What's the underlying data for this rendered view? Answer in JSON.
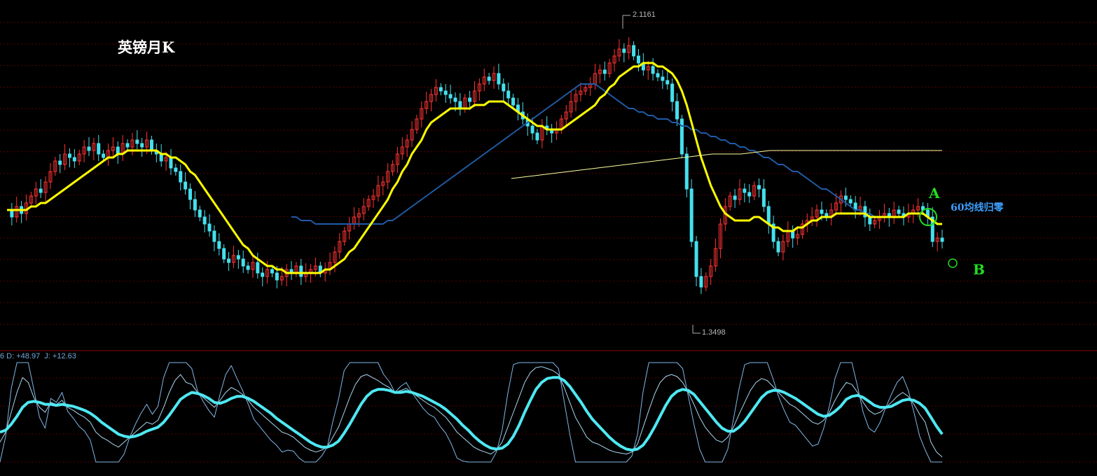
{
  "title": "英镑月K",
  "indicator_label": "6 D: +48.97  J: +12.63",
  "annotations": {
    "a": "A",
    "b": "B",
    "ma60_note": "60均线归零"
  },
  "price_high": "2.1161",
  "price_low": "1.3498",
  "colors": {
    "background": "#000000",
    "grid": "#5a0000",
    "candle_up": "#ff3333",
    "candle_down": "#45e0ee",
    "ma_main": "#ffff00",
    "ma_60": "#1f5ca8",
    "ma_long": "#ffffa0",
    "kdj_main": "#4ee8f2",
    "marker": "#22dd22"
  },
  "chart_data": [
    {
      "type": "candlestick",
      "title": "英镑月K",
      "ylim": [
        1.3,
        2.17
      ],
      "extremes": {
        "high": 2.1161,
        "low": 1.3498
      },
      "close": [
        1.64,
        1.62,
        1.65,
        1.63,
        1.66,
        1.68,
        1.7,
        1.69,
        1.72,
        1.75,
        1.78,
        1.77,
        1.8,
        1.79,
        1.78,
        1.8,
        1.82,
        1.81,
        1.83,
        1.8,
        1.79,
        1.81,
        1.82,
        1.8,
        1.83,
        1.82,
        1.84,
        1.83,
        1.82,
        1.84,
        1.81,
        1.8,
        1.78,
        1.79,
        1.76,
        1.75,
        1.72,
        1.7,
        1.67,
        1.64,
        1.62,
        1.6,
        1.58,
        1.55,
        1.53,
        1.5,
        1.49,
        1.51,
        1.5,
        1.48,
        1.47,
        1.49,
        1.46,
        1.45,
        1.47,
        1.46,
        1.44,
        1.45,
        1.47,
        1.46,
        1.48,
        1.45,
        1.46,
        1.47,
        1.48,
        1.46,
        1.47,
        1.49,
        1.52,
        1.55,
        1.58,
        1.6,
        1.62,
        1.63,
        1.65,
        1.67,
        1.68,
        1.71,
        1.72,
        1.75,
        1.77,
        1.8,
        1.82,
        1.84,
        1.87,
        1.9,
        1.93,
        1.95,
        1.97,
        1.99,
        1.98,
        1.97,
        1.96,
        1.95,
        1.93,
        1.96,
        1.95,
        1.98,
        2.0,
        2.02,
        2.01,
        2.03,
        2.0,
        1.98,
        1.96,
        1.94,
        1.92,
        1.9,
        1.88,
        1.86,
        1.84,
        1.88,
        1.87,
        1.86,
        1.87,
        1.9,
        1.92,
        1.95,
        1.97,
        1.98,
        1.99,
        2.0,
        2.03,
        2.04,
        2.03,
        2.06,
        2.08,
        2.1,
        2.09,
        2.11,
        2.08,
        2.06,
        2.04,
        2.05,
        2.03,
        2.02,
        2.01,
        2.0,
        1.95,
        1.9,
        1.8,
        1.7,
        1.55,
        1.45,
        1.42,
        1.45,
        1.48,
        1.53,
        1.6,
        1.65,
        1.68,
        1.67,
        1.7,
        1.69,
        1.68,
        1.71,
        1.7,
        1.65,
        1.6,
        1.55,
        1.52,
        1.55,
        1.58,
        1.56,
        1.57,
        1.6,
        1.61,
        1.62,
        1.64,
        1.63,
        1.62,
        1.64,
        1.66,
        1.68,
        1.67,
        1.66,
        1.64,
        1.65,
        1.62,
        1.6,
        1.61,
        1.62,
        1.63,
        1.62,
        1.64,
        1.63,
        1.62,
        1.63,
        1.64,
        1.65,
        1.64,
        1.62,
        1.55,
        1.56,
        1.55
      ],
      "ma_main": [
        1.64,
        1.64,
        1.64,
        1.64,
        1.64,
        1.65,
        1.65,
        1.66,
        1.66,
        1.67,
        1.68,
        1.69,
        1.7,
        1.71,
        1.72,
        1.73,
        1.74,
        1.75,
        1.76,
        1.77,
        1.78,
        1.79,
        1.79,
        1.8,
        1.8,
        1.81,
        1.81,
        1.81,
        1.81,
        1.81,
        1.81,
        1.81,
        1.8,
        1.8,
        1.79,
        1.79,
        1.78,
        1.77,
        1.75,
        1.74,
        1.72,
        1.7,
        1.68,
        1.66,
        1.64,
        1.62,
        1.6,
        1.58,
        1.56,
        1.54,
        1.53,
        1.51,
        1.5,
        1.49,
        1.48,
        1.48,
        1.47,
        1.47,
        1.46,
        1.46,
        1.46,
        1.46,
        1.46,
        1.46,
        1.46,
        1.46,
        1.47,
        1.47,
        1.48,
        1.49,
        1.5,
        1.52,
        1.53,
        1.55,
        1.57,
        1.59,
        1.61,
        1.63,
        1.65,
        1.67,
        1.7,
        1.72,
        1.75,
        1.77,
        1.8,
        1.82,
        1.84,
        1.87,
        1.89,
        1.9,
        1.91,
        1.92,
        1.93,
        1.93,
        1.93,
        1.93,
        1.93,
        1.94,
        1.94,
        1.94,
        1.95,
        1.95,
        1.95,
        1.95,
        1.94,
        1.93,
        1.92,
        1.91,
        1.9,
        1.89,
        1.88,
        1.88,
        1.87,
        1.87,
        1.87,
        1.87,
        1.88,
        1.89,
        1.9,
        1.91,
        1.92,
        1.93,
        1.94,
        1.96,
        1.97,
        1.99,
        2.0,
        2.02,
        2.03,
        2.04,
        2.05,
        2.05,
        2.06,
        2.06,
        2.06,
        2.05,
        2.05,
        2.04,
        2.03,
        2.01,
        1.98,
        1.94,
        1.89,
        1.84,
        1.79,
        1.75,
        1.71,
        1.68,
        1.65,
        1.63,
        1.62,
        1.61,
        1.61,
        1.61,
        1.61,
        1.62,
        1.62,
        1.61,
        1.6,
        1.59,
        1.59,
        1.58,
        1.58,
        1.58,
        1.59,
        1.59,
        1.6,
        1.61,
        1.61,
        1.62,
        1.62,
        1.62,
        1.63,
        1.63,
        1.63,
        1.63,
        1.63,
        1.63,
        1.63,
        1.62,
        1.62,
        1.62,
        1.62,
        1.62,
        1.62,
        1.62,
        1.62,
        1.63,
        1.63,
        1.63,
        1.63,
        1.62,
        1.61,
        1.6,
        1.6
      ],
      "ma_60": [
        null,
        null,
        null,
        null,
        null,
        null,
        null,
        null,
        null,
        null,
        null,
        null,
        null,
        null,
        null,
        null,
        null,
        null,
        null,
        null,
        null,
        null,
        null,
        null,
        null,
        null,
        null,
        null,
        null,
        null,
        null,
        null,
        null,
        null,
        null,
        null,
        null,
        null,
        null,
        null,
        null,
        null,
        null,
        null,
        null,
        null,
        null,
        null,
        null,
        null,
        null,
        null,
        null,
        null,
        null,
        null,
        null,
        null,
        null,
        1.62,
        1.62,
        1.61,
        1.61,
        1.61,
        1.6,
        1.6,
        1.6,
        1.6,
        1.6,
        1.6,
        1.6,
        1.6,
        1.6,
        1.6,
        1.6,
        1.6,
        1.6,
        1.6,
        1.6,
        1.61,
        1.61,
        1.62,
        1.63,
        1.64,
        1.65,
        1.66,
        1.67,
        1.68,
        1.69,
        1.7,
        1.71,
        1.72,
        1.73,
        1.74,
        1.75,
        1.76,
        1.77,
        1.78,
        1.79,
        1.8,
        1.81,
        1.82,
        1.83,
        1.84,
        1.85,
        1.86,
        1.87,
        1.88,
        1.89,
        1.9,
        1.91,
        1.92,
        1.93,
        1.94,
        1.95,
        1.96,
        1.97,
        1.98,
        1.99,
        2.0,
        2.0,
        2.0,
        2.0,
        1.99,
        1.98,
        1.97,
        1.96,
        1.95,
        1.94,
        1.93,
        1.93,
        1.92,
        1.92,
        1.91,
        1.91,
        1.9,
        1.9,
        1.9,
        1.89,
        1.89,
        1.88,
        1.88,
        1.87,
        1.87,
        1.86,
        1.86,
        1.85,
        1.85,
        1.84,
        1.84,
        1.83,
        1.83,
        1.82,
        1.82,
        1.81,
        1.81,
        1.8,
        1.79,
        1.79,
        1.78,
        1.77,
        1.77,
        1.76,
        1.75,
        1.75,
        1.74,
        1.73,
        1.72,
        1.71,
        1.7,
        1.7,
        1.69,
        1.68,
        1.67,
        1.66,
        1.65,
        1.64,
        1.64,
        1.63,
        1.63,
        1.62
      ],
      "ma_long": [
        1.73,
        1.74,
        1.75,
        1.76,
        1.77,
        1.78,
        1.79,
        1.8,
        1.8,
        1.81,
        1.81,
        1.81,
        1.81,
        1.81,
        1.81,
        1.81
      ]
    },
    {
      "type": "line",
      "title": "KDJ",
      "ylim": [
        0,
        100
      ],
      "K": [
        20,
        30,
        50,
        70,
        85,
        80,
        65,
        55,
        50,
        60,
        58,
        62,
        55,
        52,
        48,
        45,
        40,
        30,
        25,
        22,
        18,
        15,
        20,
        25,
        30,
        35,
        40,
        38,
        42,
        55,
        70,
        82,
        88,
        80,
        78,
        70,
        65,
        60,
        55,
        62,
        70,
        75,
        72,
        68,
        62,
        55,
        50,
        45,
        40,
        35,
        30,
        28,
        25,
        20,
        15,
        12,
        10,
        12,
        15,
        25,
        35,
        50,
        65,
        78,
        86,
        88,
        85,
        82,
        78,
        75,
        70,
        72,
        74,
        70,
        66,
        62,
        58,
        55,
        50,
        45,
        38,
        30,
        25,
        20,
        15,
        12,
        10,
        8,
        12,
        20,
        35,
        50,
        65,
        80,
        90,
        95,
        96,
        94,
        92,
        88,
        75,
        60,
        45,
        35,
        25,
        20,
        18,
        15,
        12,
        10,
        9,
        8,
        10,
        18,
        35,
        52,
        68,
        80,
        86,
        88,
        86,
        80,
        70,
        58,
        45,
        35,
        28,
        22,
        20,
        25,
        35,
        48,
        60,
        72,
        80,
        84,
        82,
        76,
        70,
        64,
        58,
        55,
        50,
        45,
        40,
        38,
        42,
        50,
        62,
        72,
        80,
        78,
        70,
        60,
        52,
        48,
        50,
        55,
        60,
        66,
        70,
        66,
        58,
        48,
        40,
        20,
        10,
        5
      ],
      "D": [
        30,
        32,
        38,
        46,
        55,
        60,
        61,
        60,
        58,
        58,
        57,
        58,
        57,
        56,
        54,
        52,
        49,
        45,
        40,
        36,
        32,
        28,
        26,
        25,
        26,
        28,
        31,
        33,
        35,
        40,
        47,
        55,
        63,
        67,
        70,
        69,
        67,
        64,
        60,
        59,
        61,
        64,
        66,
        66,
        64,
        61,
        57,
        53,
        49,
        44,
        40,
        36,
        32,
        28,
        24,
        20,
        17,
        15,
        15,
        17,
        21,
        29,
        38,
        48,
        58,
        66,
        71,
        73,
        73,
        72,
        70,
        70,
        71,
        70,
        68,
        66,
        63,
        60,
        57,
        53,
        48,
        43,
        37,
        32,
        26,
        21,
        17,
        14,
        13,
        14,
        18,
        26,
        37,
        50,
        62,
        73,
        80,
        84,
        85,
        85,
        82,
        76,
        68,
        60,
        51,
        43,
        37,
        31,
        25,
        20,
        16,
        13,
        12,
        13,
        17,
        25,
        35,
        46,
        57,
        66,
        71,
        73,
        72,
        68,
        61,
        54,
        47,
        40,
        34,
        31,
        31,
        35,
        41,
        49,
        57,
        65,
        70,
        72,
        72,
        70,
        67,
        64,
        60,
        56,
        52,
        48,
        46,
        47,
        51,
        56,
        63,
        66,
        67,
        65,
        61,
        57,
        55,
        55,
        56,
        59,
        62,
        63,
        62,
        59,
        54,
        45,
        36,
        28
      ],
      "J": [
        0,
        26,
        74,
        118,
        145,
        120,
        73,
        45,
        34,
        64,
        60,
        70,
        51,
        44,
        36,
        31,
        22,
        0,
        0,
        0,
        0,
        0,
        8,
        25,
        38,
        49,
        58,
        48,
        56,
        85,
        116,
        136,
        138,
        106,
        94,
        72,
        61,
        52,
        45,
        68,
        88,
        97,
        84,
        72,
        58,
        43,
        36,
        29,
        22,
        17,
        10,
        12,
        11,
        4,
        0,
        0,
        0,
        6,
        15,
        41,
        63,
        92,
        119,
        138,
        142,
        132,
        113,
        100,
        88,
        81,
        70,
        76,
        80,
        70,
        62,
        54,
        48,
        45,
        36,
        29,
        18,
        4,
        1,
        0,
        0,
        0,
        0,
        0,
        10,
        32,
        69,
        98,
        121,
        140,
        146,
        139,
        128,
        114,
        106,
        94,
        61,
        28,
        0,
        0,
        0,
        0,
        0,
        0,
        0,
        0,
        0,
        0,
        6,
        28,
        71,
        106,
        134,
        148,
        144,
        132,
        116,
        94,
        66,
        38,
        13,
        0,
        0,
        0,
        0,
        13,
        43,
        74,
        98,
        118,
        126,
        122,
        106,
        84,
        66,
        52,
        40,
        37,
        30,
        23,
        16,
        18,
        34,
        56,
        84,
        104,
        114,
        102,
        76,
        50,
        34,
        30,
        40,
        55,
        68,
        80,
        86,
        72,
        50,
        26,
        12,
        0,
        0,
        0
      ]
    }
  ]
}
